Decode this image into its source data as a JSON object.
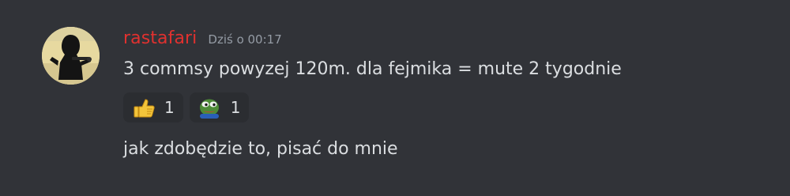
{
  "message": {
    "author": "rastafari",
    "timestamp": "Dziś o 00:17",
    "lines": [
      "3 commsy powyzej 120m. dla fejmika = mute 2 tygodnie",
      "jak zdobędzie to, pisać do mnie"
    ],
    "reactions": [
      {
        "emoji": "thumbs-up-icon",
        "count": "1"
      },
      {
        "emoji": "pepe-frog-emoji-icon",
        "count": "1"
      }
    ]
  },
  "colors": {
    "background": "#313338",
    "username": "#e0312f",
    "timestamp": "#949ba4",
    "text": "#dbdee1",
    "reaction_bg": "#2b2d31"
  }
}
